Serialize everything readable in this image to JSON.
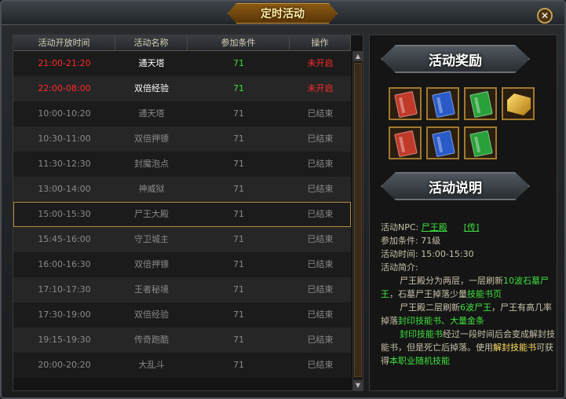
{
  "window": {
    "title": "定时活动"
  },
  "table": {
    "headers": [
      "活动开放时间",
      "活动名称",
      "参加条件",
      "操作"
    ],
    "rows": [
      {
        "time": "21:00-21:20",
        "name": "通天塔",
        "cond": "71",
        "status": "未开启"
      },
      {
        "time": "22:00-08:00",
        "name": "双倍经验",
        "cond": "71",
        "status": "未开启"
      },
      {
        "time": "10:00-10:20",
        "name": "通天塔",
        "cond": "71",
        "status": "已结束"
      },
      {
        "time": "10:30-11:00",
        "name": "双倍押镖",
        "cond": "71",
        "status": "已结束"
      },
      {
        "time": "11:30-12:30",
        "name": "封魔泡点",
        "cond": "71",
        "status": "已结束"
      },
      {
        "time": "13:00-14:00",
        "name": "神威狱",
        "cond": "71",
        "status": "已结束"
      },
      {
        "time": "15:00-15:30",
        "name": "尸王大殿",
        "cond": "71",
        "status": "已结束"
      },
      {
        "time": "15:45-16:00",
        "name": "守卫城主",
        "cond": "71",
        "status": "已结束"
      },
      {
        "time": "16:00-16:30",
        "name": "双倍押镖",
        "cond": "71",
        "status": "已结束"
      },
      {
        "time": "17:10-17:30",
        "name": "王者秘境",
        "cond": "71",
        "status": "已结束"
      },
      {
        "time": "17:30-19:00",
        "name": "双倍经验",
        "cond": "71",
        "status": "已结束"
      },
      {
        "time": "19:15-19:30",
        "name": "传奇跑酷",
        "cond": "71",
        "status": "已结束"
      },
      {
        "time": "20:00-20:20",
        "name": "大乱斗",
        "cond": "71",
        "status": "已结束"
      }
    ]
  },
  "rewards": {
    "title": "活动奖励"
  },
  "description": {
    "title": "活动说明",
    "npc_label": "活动NPC:",
    "npc_name": "尸王殿",
    "npc_teleport": "[传]",
    "cond_label": "参加条件:",
    "cond_value": "71级",
    "time_label": "活动时间:",
    "time_value": "15:00-15:30",
    "intro_label": "活动简介:",
    "p1a": "尸王殿分为两层，一层刷新",
    "p1b": "10波石墓尸王",
    "p1c": "，石墓尸王掉落少量",
    "p1d": "技能书页",
    "p2a": "尸王殿二层刷新",
    "p2b": "6波尸王",
    "p2c": "，尸王有高几率掉落",
    "p2d": "封印技能书、大量金条",
    "p3a": "封印技能书",
    "p3b": "经过一段时间后会变成解封技能书，但是死亡后掉落。使用",
    "p3c": "解封技能书",
    "p3d": "可获得",
    "p3e": "本职业随机技能"
  },
  "colors": {
    "active_time": "#ff2a2a",
    "cond": "#36e036",
    "inactive": "#8a8a8a",
    "highlight": "#3ee03e"
  }
}
